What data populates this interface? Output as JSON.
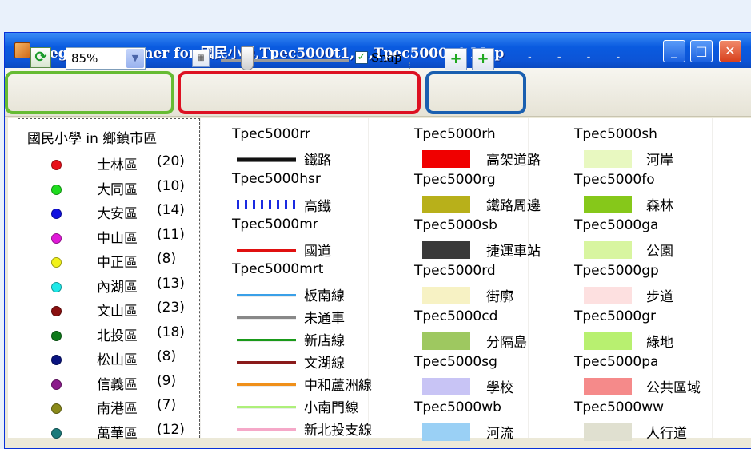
{
  "window": {
    "title": "Legend Designer for 國民小學,Tpec5000t1,...,Tpec5000a1 Map",
    "buttons": {
      "minimize": "_",
      "maximize": "□",
      "close": "✕"
    }
  },
  "toolbar": {
    "refresh_icon": "refresh-icon",
    "zoom_value": "85%",
    "snap_label": "Snap",
    "snap_checked": true,
    "slider_value": 0.2
  },
  "left_panel": {
    "title": "國民小學 in 鄉鎮市區",
    "districts": [
      {
        "name": "士林區",
        "count": "(20)",
        "color": "#e8101a"
      },
      {
        "name": "大同區",
        "count": "(10)",
        "color": "#1fdc1f"
      },
      {
        "name": "大安區",
        "count": "(14)",
        "color": "#1010e0"
      },
      {
        "name": "中山區",
        "count": "(11)",
        "color": "#e019d8"
      },
      {
        "name": "中正區",
        "count": "(8)",
        "color": "#f2f21a"
      },
      {
        "name": "內湖區",
        "count": "(13)",
        "color": "#1ee8e8"
      },
      {
        "name": "文山區",
        "count": "(23)",
        "color": "#8a1010"
      },
      {
        "name": "北投區",
        "count": "(18)",
        "color": "#0e7a1a"
      },
      {
        "name": "松山區",
        "count": "(8)",
        "color": "#0a1480"
      },
      {
        "name": "信義區",
        "count": "(9)",
        "color": "#8a1a8a"
      },
      {
        "name": "南港區",
        "count": "(7)",
        "color": "#8a8a1a"
      },
      {
        "name": "萬華區",
        "count": "(12)",
        "color": "#1a7a7a"
      }
    ]
  },
  "legend": {
    "col1": [
      {
        "layer": "Tpec5000rr",
        "label": "鐵路",
        "style": "rail",
        "color": "#111111"
      },
      {
        "layer": "Tpec5000hsr",
        "label": "高鐵",
        "style": "dash",
        "color": "#1a2ae0"
      },
      {
        "layer": "Tpec5000mr",
        "label": "國道",
        "style": "line",
        "color": "#e01010"
      },
      {
        "layer": "Tpec5000mrt",
        "label": "板南線",
        "style": "line",
        "color": "#3aa0e8"
      },
      {
        "layer": "",
        "label": "未通車",
        "style": "line",
        "color": "#888888"
      },
      {
        "layer": "",
        "label": "新店線",
        "style": "line",
        "color": "#1a9a1a"
      },
      {
        "layer": "",
        "label": "文湖線",
        "style": "line",
        "color": "#8a1a1a"
      },
      {
        "layer": "",
        "label": "中和蘆洲線",
        "style": "line",
        "color": "#f0901a"
      },
      {
        "layer": "",
        "label": "小南門線",
        "style": "line",
        "color": "#aef07a"
      },
      {
        "layer": "",
        "label": "新北投支線",
        "style": "line",
        "color": "#f5a8c8"
      }
    ],
    "col2": [
      {
        "layer": "Tpec5000rh",
        "label": "高架道路",
        "color": "#f00000"
      },
      {
        "layer": "Tpec5000rg",
        "label": "鐵路周邊",
        "color": "#b8b01a"
      },
      {
        "layer": "Tpec5000sb",
        "label": "捷運車站",
        "color": "#3a3a3a"
      },
      {
        "layer": "Tpec5000rd",
        "label": "街廓",
        "color": "#f7f2c4"
      },
      {
        "layer": "Tpec5000cd",
        "label": "分隔島",
        "color": "#9ec860"
      },
      {
        "layer": "Tpec5000sg",
        "label": "學校",
        "color": "#c8c4f5"
      },
      {
        "layer": "Tpec5000wb",
        "label": "河流",
        "color": "#9ad0f5"
      }
    ],
    "col3": [
      {
        "layer": "Tpec5000sh",
        "label": "河岸",
        "color": "#e8f8c0"
      },
      {
        "layer": "Tpec5000fo",
        "label": "森林",
        "color": "#86c81a"
      },
      {
        "layer": "Tpec5000ga",
        "label": "公園",
        "color": "#d8f5a0"
      },
      {
        "layer": "Tpec5000gp",
        "label": "步道",
        "color": "#fde0e0"
      },
      {
        "layer": "Tpec5000gr",
        "label": "綠地",
        "color": "#b8f070"
      },
      {
        "layer": "Tpec5000pa",
        "label": "公共區域",
        "color": "#f58a8a"
      },
      {
        "layer": "Tpec5000ww",
        "label": "人行道",
        "color": "#e0e0d0"
      }
    ]
  }
}
